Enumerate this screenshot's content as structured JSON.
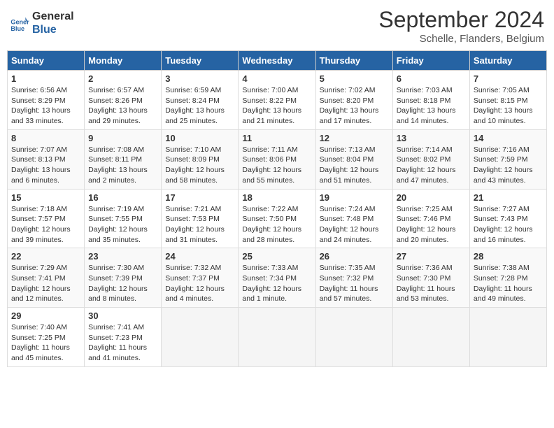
{
  "logo": {
    "line1": "General",
    "line2": "Blue"
  },
  "title": "September 2024",
  "subtitle": "Schelle, Flanders, Belgium",
  "days_header": [
    "Sunday",
    "Monday",
    "Tuesday",
    "Wednesday",
    "Thursday",
    "Friday",
    "Saturday"
  ],
  "weeks": [
    [
      {
        "day": "1",
        "detail": "Sunrise: 6:56 AM\nSunset: 8:29 PM\nDaylight: 13 hours\nand 33 minutes."
      },
      {
        "day": "2",
        "detail": "Sunrise: 6:57 AM\nSunset: 8:26 PM\nDaylight: 13 hours\nand 29 minutes."
      },
      {
        "day": "3",
        "detail": "Sunrise: 6:59 AM\nSunset: 8:24 PM\nDaylight: 13 hours\nand 25 minutes."
      },
      {
        "day": "4",
        "detail": "Sunrise: 7:00 AM\nSunset: 8:22 PM\nDaylight: 13 hours\nand 21 minutes."
      },
      {
        "day": "5",
        "detail": "Sunrise: 7:02 AM\nSunset: 8:20 PM\nDaylight: 13 hours\nand 17 minutes."
      },
      {
        "day": "6",
        "detail": "Sunrise: 7:03 AM\nSunset: 8:18 PM\nDaylight: 13 hours\nand 14 minutes."
      },
      {
        "day": "7",
        "detail": "Sunrise: 7:05 AM\nSunset: 8:15 PM\nDaylight: 13 hours\nand 10 minutes."
      }
    ],
    [
      {
        "day": "8",
        "detail": "Sunrise: 7:07 AM\nSunset: 8:13 PM\nDaylight: 13 hours\nand 6 minutes."
      },
      {
        "day": "9",
        "detail": "Sunrise: 7:08 AM\nSunset: 8:11 PM\nDaylight: 13 hours\nand 2 minutes."
      },
      {
        "day": "10",
        "detail": "Sunrise: 7:10 AM\nSunset: 8:09 PM\nDaylight: 12 hours\nand 58 minutes."
      },
      {
        "day": "11",
        "detail": "Sunrise: 7:11 AM\nSunset: 8:06 PM\nDaylight: 12 hours\nand 55 minutes."
      },
      {
        "day": "12",
        "detail": "Sunrise: 7:13 AM\nSunset: 8:04 PM\nDaylight: 12 hours\nand 51 minutes."
      },
      {
        "day": "13",
        "detail": "Sunrise: 7:14 AM\nSunset: 8:02 PM\nDaylight: 12 hours\nand 47 minutes."
      },
      {
        "day": "14",
        "detail": "Sunrise: 7:16 AM\nSunset: 7:59 PM\nDaylight: 12 hours\nand 43 minutes."
      }
    ],
    [
      {
        "day": "15",
        "detail": "Sunrise: 7:18 AM\nSunset: 7:57 PM\nDaylight: 12 hours\nand 39 minutes."
      },
      {
        "day": "16",
        "detail": "Sunrise: 7:19 AM\nSunset: 7:55 PM\nDaylight: 12 hours\nand 35 minutes."
      },
      {
        "day": "17",
        "detail": "Sunrise: 7:21 AM\nSunset: 7:53 PM\nDaylight: 12 hours\nand 31 minutes."
      },
      {
        "day": "18",
        "detail": "Sunrise: 7:22 AM\nSunset: 7:50 PM\nDaylight: 12 hours\nand 28 minutes."
      },
      {
        "day": "19",
        "detail": "Sunrise: 7:24 AM\nSunset: 7:48 PM\nDaylight: 12 hours\nand 24 minutes."
      },
      {
        "day": "20",
        "detail": "Sunrise: 7:25 AM\nSunset: 7:46 PM\nDaylight: 12 hours\nand 20 minutes."
      },
      {
        "day": "21",
        "detail": "Sunrise: 7:27 AM\nSunset: 7:43 PM\nDaylight: 12 hours\nand 16 minutes."
      }
    ],
    [
      {
        "day": "22",
        "detail": "Sunrise: 7:29 AM\nSunset: 7:41 PM\nDaylight: 12 hours\nand 12 minutes."
      },
      {
        "day": "23",
        "detail": "Sunrise: 7:30 AM\nSunset: 7:39 PM\nDaylight: 12 hours\nand 8 minutes."
      },
      {
        "day": "24",
        "detail": "Sunrise: 7:32 AM\nSunset: 7:37 PM\nDaylight: 12 hours\nand 4 minutes."
      },
      {
        "day": "25",
        "detail": "Sunrise: 7:33 AM\nSunset: 7:34 PM\nDaylight: 12 hours\nand 1 minute."
      },
      {
        "day": "26",
        "detail": "Sunrise: 7:35 AM\nSunset: 7:32 PM\nDaylight: 11 hours\nand 57 minutes."
      },
      {
        "day": "27",
        "detail": "Sunrise: 7:36 AM\nSunset: 7:30 PM\nDaylight: 11 hours\nand 53 minutes."
      },
      {
        "day": "28",
        "detail": "Sunrise: 7:38 AM\nSunset: 7:28 PM\nDaylight: 11 hours\nand 49 minutes."
      }
    ],
    [
      {
        "day": "29",
        "detail": "Sunrise: 7:40 AM\nSunset: 7:25 PM\nDaylight: 11 hours\nand 45 minutes."
      },
      {
        "day": "30",
        "detail": "Sunrise: 7:41 AM\nSunset: 7:23 PM\nDaylight: 11 hours\nand 41 minutes."
      },
      {
        "day": "",
        "detail": ""
      },
      {
        "day": "",
        "detail": ""
      },
      {
        "day": "",
        "detail": ""
      },
      {
        "day": "",
        "detail": ""
      },
      {
        "day": "",
        "detail": ""
      }
    ]
  ]
}
